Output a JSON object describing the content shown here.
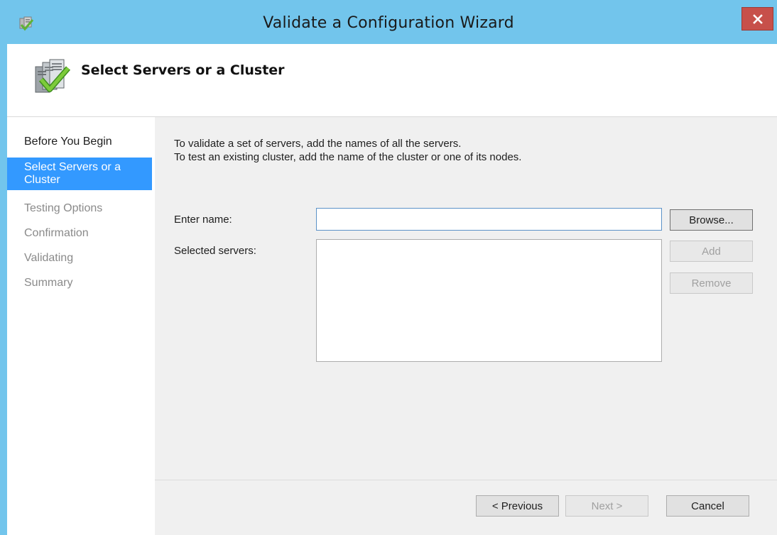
{
  "window": {
    "title": "Validate a Configuration Wizard",
    "close_label": "x",
    "app_icon": "cluster-wizard-icon"
  },
  "header": {
    "title": "Select Servers or a Cluster",
    "icon": "servers-checkmark-icon"
  },
  "nav": {
    "items": [
      {
        "label": "Before You Begin",
        "state": "done"
      },
      {
        "label": "Select Servers or a Cluster",
        "state": "current"
      },
      {
        "label": "Testing Options",
        "state": "pending"
      },
      {
        "label": "Confirmation",
        "state": "pending"
      },
      {
        "label": "Validating",
        "state": "pending"
      },
      {
        "label": "Summary",
        "state": "pending"
      }
    ]
  },
  "content": {
    "instruction_line1": "To validate a set of servers, add the names of all the servers.",
    "instruction_line2": "To test an existing cluster, add the name of the cluster or one of its nodes.",
    "enter_name_label": "Enter name:",
    "enter_name_value": "",
    "selected_servers_label": "Selected servers:",
    "selected_servers": [],
    "browse_label": "Browse...",
    "add_label": "Add",
    "remove_label": "Remove"
  },
  "footer": {
    "previous_label": "< Previous",
    "next_label": "Next >",
    "cancel_label": "Cancel"
  },
  "colors": {
    "title_bar": "#72c5ec",
    "close_button": "#c7504a",
    "selection": "#3399ff",
    "disabled_text": "#a0a0a0"
  }
}
